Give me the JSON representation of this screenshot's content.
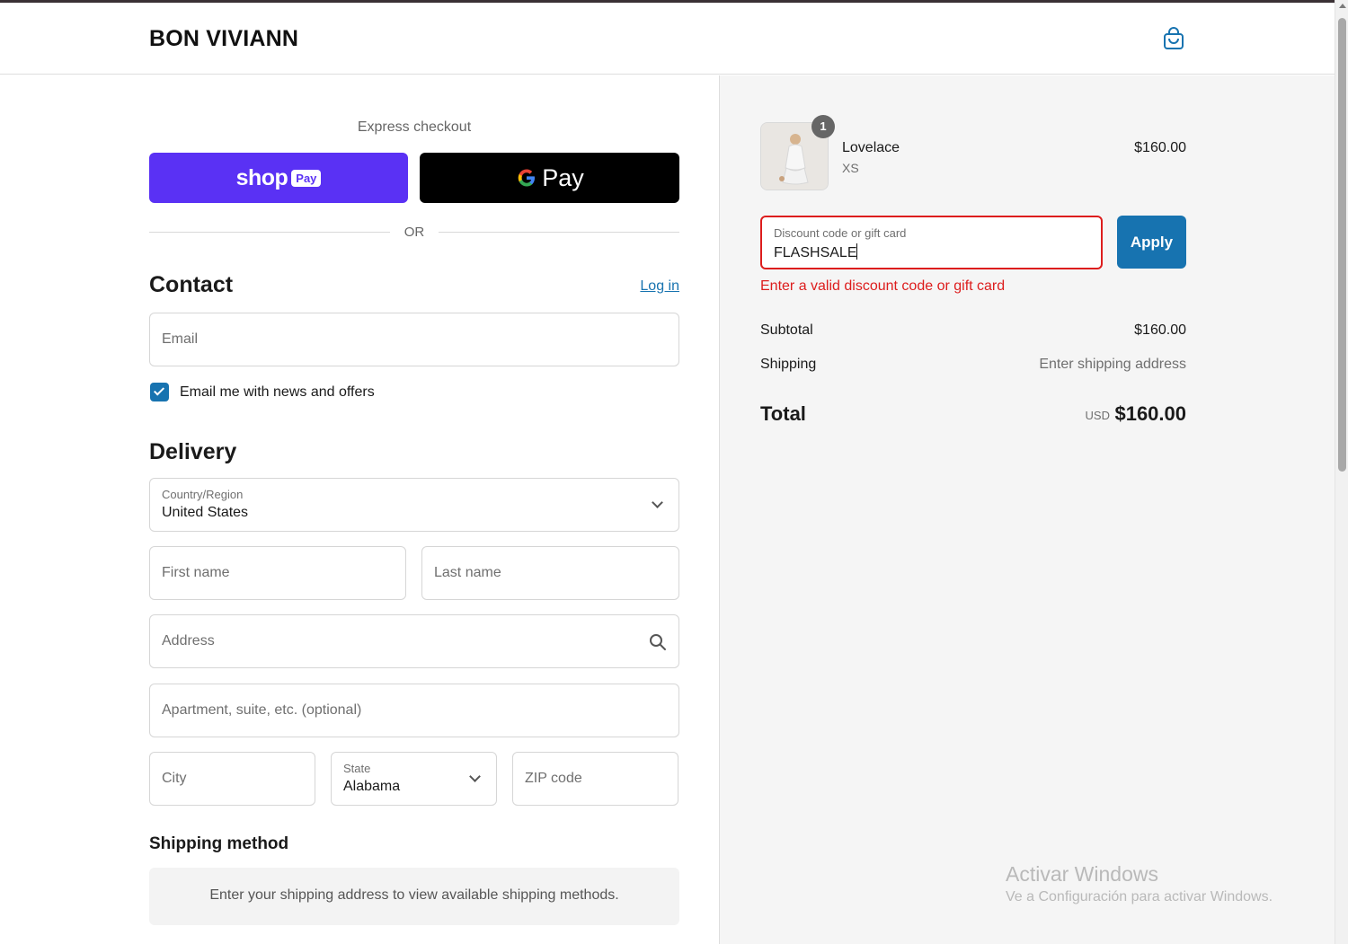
{
  "header": {
    "brand": "BON VIVIANN",
    "cart_icon": "shopping-bag-icon"
  },
  "express": {
    "label": "Express checkout",
    "shop_pay": {
      "word": "shop",
      "badge": "Pay",
      "color": "#5a31f4"
    },
    "gpay": {
      "word": "Pay",
      "icon": "google-g-icon"
    },
    "or_label": "OR"
  },
  "contact": {
    "title": "Contact",
    "login_link": "Log in",
    "email_placeholder": "Email",
    "newsletter_label": "Email me with news and offers",
    "newsletter_checked": true
  },
  "delivery": {
    "title": "Delivery",
    "country": {
      "label": "Country/Region",
      "value": "United States"
    },
    "first_name_placeholder": "First name",
    "last_name_placeholder": "Last name",
    "address_placeholder": "Address",
    "apartment_placeholder": "Apartment, suite, etc. (optional)",
    "city_placeholder": "City",
    "state": {
      "label": "State",
      "value": "Alabama"
    },
    "zip_placeholder": "ZIP code"
  },
  "shipping_method": {
    "title": "Shipping method",
    "message": "Enter your shipping address to view available shipping methods."
  },
  "summary": {
    "item": {
      "quantity": "1",
      "name": "Lovelace",
      "variant": "XS",
      "price": "$160.00"
    },
    "discount": {
      "label": "Discount code or gift card",
      "value": "FLASHSALE",
      "apply_label": "Apply",
      "error": "Enter a valid discount code or gift card"
    },
    "subtotal": {
      "label": "Subtotal",
      "value": "$160.00"
    },
    "shipping": {
      "label": "Shipping",
      "value": "Enter shipping address"
    },
    "total": {
      "label": "Total",
      "currency": "USD",
      "value": "$160.00"
    }
  },
  "watermark": {
    "title": "Activar Windows",
    "subtitle": "Ve a Configuración para activar Windows."
  },
  "colors": {
    "accent": "#1773b0",
    "error": "#dd1d1d",
    "summary_bg": "#f5f5f5"
  }
}
